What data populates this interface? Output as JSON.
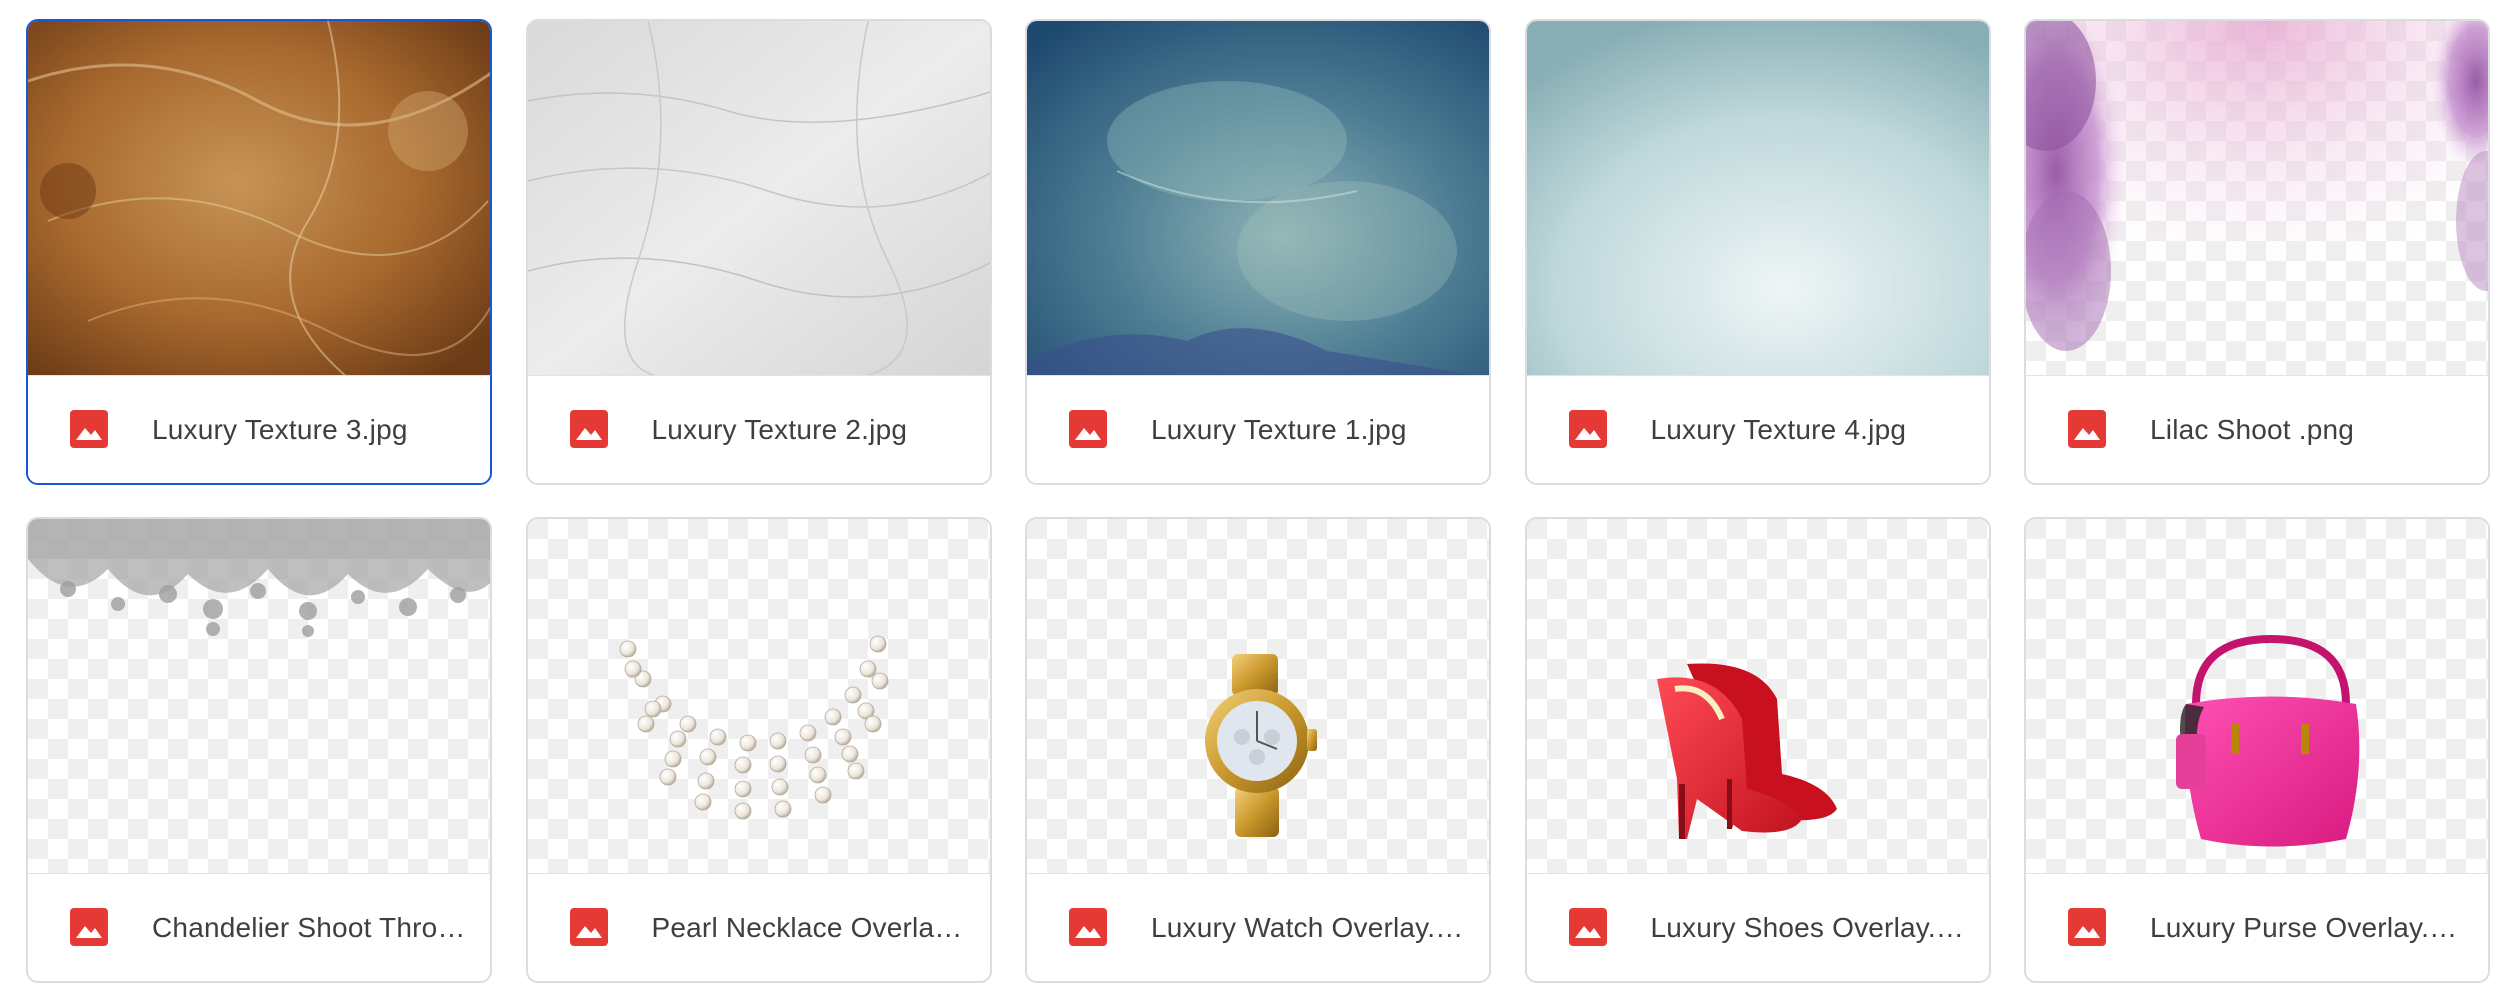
{
  "files": [
    {
      "name": "Luxury Texture 3.jpg",
      "selected": true,
      "icon": "image-file-icon",
      "thumb": "brown-leather-texture"
    },
    {
      "name": "Luxury Texture 2.jpg",
      "selected": false,
      "icon": "image-file-icon",
      "thumb": "white-leather-texture"
    },
    {
      "name": "Luxury Texture 1.jpg",
      "selected": false,
      "icon": "image-file-icon",
      "thumb": "blue-watercolor-texture"
    },
    {
      "name": "Luxury Texture 4.jpg",
      "selected": false,
      "icon": "image-file-icon",
      "thumb": "pale-teal-gradient"
    },
    {
      "name": "Lilac Shoot .png",
      "selected": false,
      "icon": "image-file-icon",
      "thumb": "lilac-overlay"
    },
    {
      "name": "Chandelier Shoot Thro…",
      "selected": false,
      "icon": "image-file-icon",
      "thumb": "chandelier-overlay"
    },
    {
      "name": "Pearl Necklace Overlay…",
      "selected": false,
      "icon": "image-file-icon",
      "thumb": "pearl-necklace"
    },
    {
      "name": "Luxury Watch Overlay.…",
      "selected": false,
      "icon": "image-file-icon",
      "thumb": "gold-watch"
    },
    {
      "name": "Luxury Shoes Overlay.…",
      "selected": false,
      "icon": "image-file-icon",
      "thumb": "red-heels"
    },
    {
      "name": "Luxury Purse Overlay.p…",
      "selected": false,
      "icon": "image-file-icon",
      "thumb": "pink-handbag"
    }
  ],
  "colors": {
    "selected_border": "#1a57d6",
    "card_border": "#dadce0",
    "file_icon_red": "#e53935",
    "file_name_text": "#3c4043"
  }
}
